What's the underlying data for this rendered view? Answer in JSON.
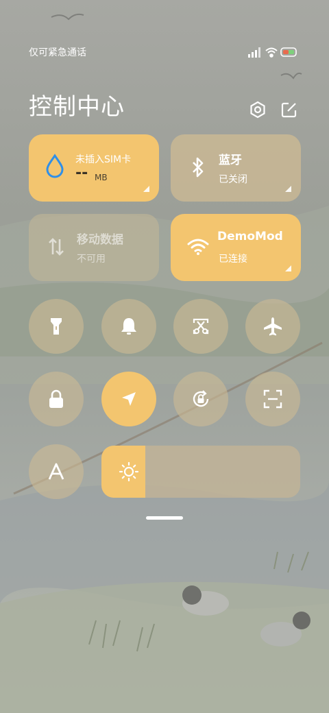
{
  "status": {
    "carrier_text": "仅可紧急通话"
  },
  "header": {
    "title": "控制中心",
    "settings_icon": "gear-icon",
    "edit_icon": "edit-icon"
  },
  "tiles": {
    "data_usage": {
      "label": "未插入SIM卡",
      "value": "--",
      "unit": "MB"
    },
    "bluetooth": {
      "name": "蓝牙",
      "status": "已关闭"
    },
    "mobile_data": {
      "name": "移动数据",
      "status": "不可用"
    },
    "wifi": {
      "name": "DemoMod",
      "status": "已连接"
    }
  },
  "toggles": [
    {
      "name": "flashlight",
      "icon": "flashlight-icon",
      "active": false
    },
    {
      "name": "ring",
      "icon": "bell-icon",
      "active": false
    },
    {
      "name": "screenshot",
      "icon": "scissors-icon",
      "active": false
    },
    {
      "name": "airplane",
      "icon": "airplane-icon",
      "active": false
    },
    {
      "name": "lock",
      "icon": "lock-icon",
      "active": false
    },
    {
      "name": "location",
      "icon": "location-arrow-icon",
      "active": true
    },
    {
      "name": "rotation-lock",
      "icon": "rotation-lock-icon",
      "active": false
    },
    {
      "name": "scanner",
      "icon": "scan-icon",
      "active": false
    },
    {
      "name": "auto-brightness",
      "icon": "letter-a-icon",
      "active": false
    }
  ],
  "brightness": {
    "level": 0.22,
    "icon": "sun-icon"
  },
  "colors": {
    "accent": "#f3c56f",
    "tile_off": "#cdba94",
    "text": "#ffffff",
    "wifi_blue": "#2f8fe8"
  }
}
